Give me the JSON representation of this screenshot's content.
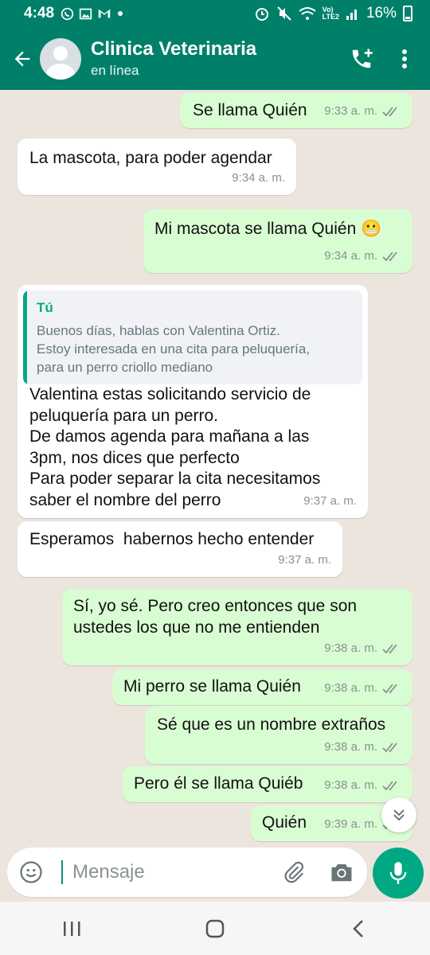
{
  "status_bar": {
    "time": "4:48",
    "network": "Vo)\nLTE2",
    "battery": "16%"
  },
  "header": {
    "contact_name": "Clinica Veterinaria",
    "contact_status": "en línea"
  },
  "messages": [
    {
      "dir": "out",
      "text": "Se llama Quién",
      "time": "9:33 a. m.",
      "read": true
    },
    {
      "dir": "in",
      "text": "La mascota, para poder agendar",
      "time": "9:34 a. m."
    },
    {
      "dir": "out",
      "text": "Mi mascota se llama Quién 😬",
      "time": "9:34 a. m.",
      "read": true
    },
    {
      "dir": "in",
      "quote": {
        "author": "Tú",
        "text": "Buenos días, hablas con Valentina Ortiz.\nEstoy interesada en una cita para peluquería,\npara un perro criollo mediano"
      },
      "text": "Valentina estas solicitando servicio de\npeluquería para un perro.\nDe damos agenda para mañana a las\n3pm, nos dices que perfecto\nPara poder separar la cita necesitamos\nsaber el nombre del perro",
      "time": "9:37 a. m."
    },
    {
      "dir": "in",
      "text": "Esperamos  habernos hecho entender",
      "time": "9:37 a. m."
    },
    {
      "dir": "out",
      "text": "Sí, yo sé. Pero creo entonces que son\nustedes los que no me entienden",
      "time": "9:38 a. m.",
      "read": true
    },
    {
      "dir": "out",
      "text": "Mi perro se llama Quién",
      "time": "9:38 a. m.",
      "read": true
    },
    {
      "dir": "out",
      "text": "Sé que es un nombre extraños",
      "time": "9:38 a. m.",
      "read": true
    },
    {
      "dir": "out",
      "text": "Pero él se llama Quiéb",
      "time": "9:38 a. m.",
      "read": true
    },
    {
      "dir": "out",
      "text": "Quién",
      "time": "9:39 a. m.",
      "read": true
    }
  ],
  "composer": {
    "placeholder": "Mensaje"
  },
  "colors": {
    "header": "#008069",
    "outgoing_bubble": "#d9fdd3",
    "incoming_bubble": "#ffffff",
    "chat_bg": "#ece5dd",
    "accent": "#00a884",
    "read_ticks": "#8a8f91"
  },
  "icons": {
    "back": "arrow-left-icon",
    "call": "add-call-icon",
    "menu": "more-vert-icon",
    "emoji": "emoji-icon",
    "attach": "paperclip-icon",
    "camera": "camera-icon",
    "mic": "mic-icon",
    "scroll": "chevrons-down-icon"
  }
}
